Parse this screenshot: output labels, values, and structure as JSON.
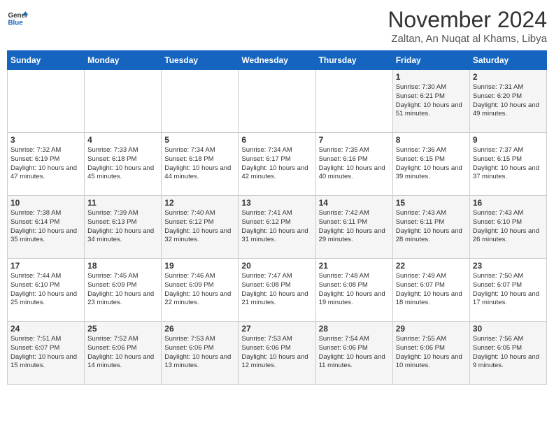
{
  "logo": {
    "general": "General",
    "blue": "Blue"
  },
  "header": {
    "month_year": "November 2024",
    "location": "Zaltan, An Nuqat al Khams, Libya"
  },
  "days_of_week": [
    "Sunday",
    "Monday",
    "Tuesday",
    "Wednesday",
    "Thursday",
    "Friday",
    "Saturday"
  ],
  "weeks": [
    [
      {
        "day": "",
        "content": ""
      },
      {
        "day": "",
        "content": ""
      },
      {
        "day": "",
        "content": ""
      },
      {
        "day": "",
        "content": ""
      },
      {
        "day": "",
        "content": ""
      },
      {
        "day": "1",
        "content": "Sunrise: 7:30 AM\nSunset: 6:21 PM\nDaylight: 10 hours and 51 minutes."
      },
      {
        "day": "2",
        "content": "Sunrise: 7:31 AM\nSunset: 6:20 PM\nDaylight: 10 hours and 49 minutes."
      }
    ],
    [
      {
        "day": "3",
        "content": "Sunrise: 7:32 AM\nSunset: 6:19 PM\nDaylight: 10 hours and 47 minutes."
      },
      {
        "day": "4",
        "content": "Sunrise: 7:33 AM\nSunset: 6:18 PM\nDaylight: 10 hours and 45 minutes."
      },
      {
        "day": "5",
        "content": "Sunrise: 7:34 AM\nSunset: 6:18 PM\nDaylight: 10 hours and 44 minutes."
      },
      {
        "day": "6",
        "content": "Sunrise: 7:34 AM\nSunset: 6:17 PM\nDaylight: 10 hours and 42 minutes."
      },
      {
        "day": "7",
        "content": "Sunrise: 7:35 AM\nSunset: 6:16 PM\nDaylight: 10 hours and 40 minutes."
      },
      {
        "day": "8",
        "content": "Sunrise: 7:36 AM\nSunset: 6:15 PM\nDaylight: 10 hours and 39 minutes."
      },
      {
        "day": "9",
        "content": "Sunrise: 7:37 AM\nSunset: 6:15 PM\nDaylight: 10 hours and 37 minutes."
      }
    ],
    [
      {
        "day": "10",
        "content": "Sunrise: 7:38 AM\nSunset: 6:14 PM\nDaylight: 10 hours and 35 minutes."
      },
      {
        "day": "11",
        "content": "Sunrise: 7:39 AM\nSunset: 6:13 PM\nDaylight: 10 hours and 34 minutes."
      },
      {
        "day": "12",
        "content": "Sunrise: 7:40 AM\nSunset: 6:12 PM\nDaylight: 10 hours and 32 minutes."
      },
      {
        "day": "13",
        "content": "Sunrise: 7:41 AM\nSunset: 6:12 PM\nDaylight: 10 hours and 31 minutes."
      },
      {
        "day": "14",
        "content": "Sunrise: 7:42 AM\nSunset: 6:11 PM\nDaylight: 10 hours and 29 minutes."
      },
      {
        "day": "15",
        "content": "Sunrise: 7:43 AM\nSunset: 6:11 PM\nDaylight: 10 hours and 28 minutes."
      },
      {
        "day": "16",
        "content": "Sunrise: 7:43 AM\nSunset: 6:10 PM\nDaylight: 10 hours and 26 minutes."
      }
    ],
    [
      {
        "day": "17",
        "content": "Sunrise: 7:44 AM\nSunset: 6:10 PM\nDaylight: 10 hours and 25 minutes."
      },
      {
        "day": "18",
        "content": "Sunrise: 7:45 AM\nSunset: 6:09 PM\nDaylight: 10 hours and 23 minutes."
      },
      {
        "day": "19",
        "content": "Sunrise: 7:46 AM\nSunset: 6:09 PM\nDaylight: 10 hours and 22 minutes."
      },
      {
        "day": "20",
        "content": "Sunrise: 7:47 AM\nSunset: 6:08 PM\nDaylight: 10 hours and 21 minutes."
      },
      {
        "day": "21",
        "content": "Sunrise: 7:48 AM\nSunset: 6:08 PM\nDaylight: 10 hours and 19 minutes."
      },
      {
        "day": "22",
        "content": "Sunrise: 7:49 AM\nSunset: 6:07 PM\nDaylight: 10 hours and 18 minutes."
      },
      {
        "day": "23",
        "content": "Sunrise: 7:50 AM\nSunset: 6:07 PM\nDaylight: 10 hours and 17 minutes."
      }
    ],
    [
      {
        "day": "24",
        "content": "Sunrise: 7:51 AM\nSunset: 6:07 PM\nDaylight: 10 hours and 15 minutes."
      },
      {
        "day": "25",
        "content": "Sunrise: 7:52 AM\nSunset: 6:06 PM\nDaylight: 10 hours and 14 minutes."
      },
      {
        "day": "26",
        "content": "Sunrise: 7:53 AM\nSunset: 6:06 PM\nDaylight: 10 hours and 13 minutes."
      },
      {
        "day": "27",
        "content": "Sunrise: 7:53 AM\nSunset: 6:06 PM\nDaylight: 10 hours and 12 minutes."
      },
      {
        "day": "28",
        "content": "Sunrise: 7:54 AM\nSunset: 6:06 PM\nDaylight: 10 hours and 11 minutes."
      },
      {
        "day": "29",
        "content": "Sunrise: 7:55 AM\nSunset: 6:06 PM\nDaylight: 10 hours and 10 minutes."
      },
      {
        "day": "30",
        "content": "Sunrise: 7:56 AM\nSunset: 6:05 PM\nDaylight: 10 hours and 9 minutes."
      }
    ]
  ]
}
